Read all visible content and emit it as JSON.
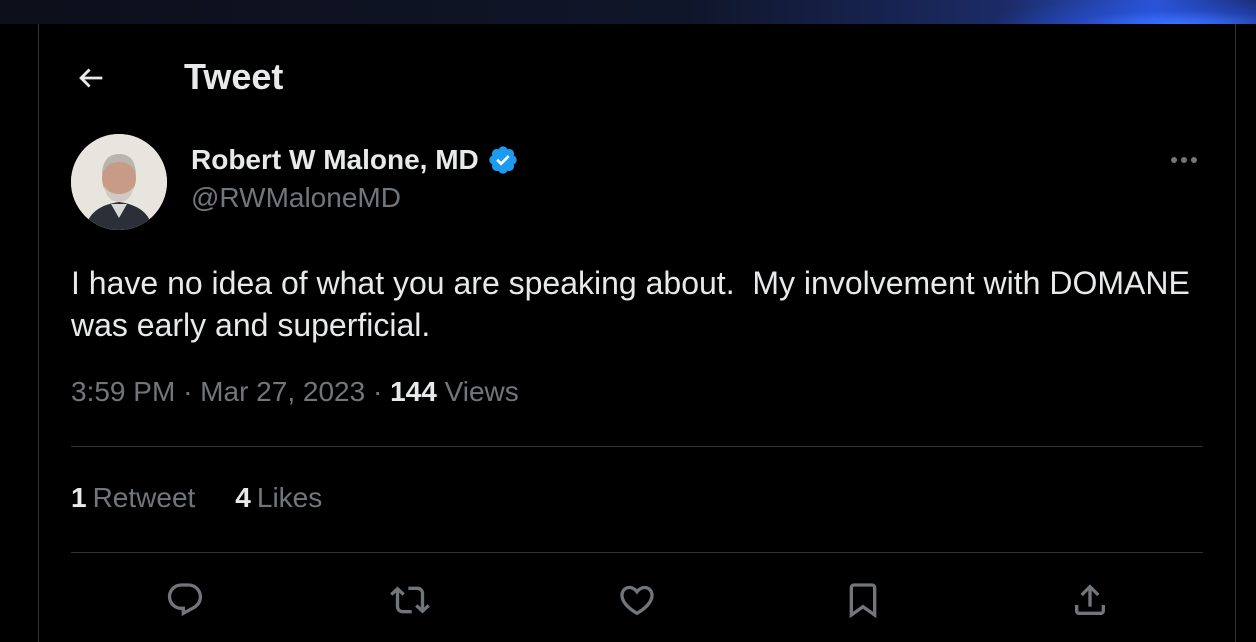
{
  "header": {
    "title": "Tweet",
    "back_icon": "arrow-left-icon"
  },
  "author": {
    "display_name": "Robert W Malone, MD",
    "handle": "@RWMaloneMD",
    "verified_icon": "verified-badge-icon",
    "verified_color": "#1d9bf0"
  },
  "tweet": {
    "text": "I have no idea of what you are speaking about.  My involvement with DOMANE was early and superficial.",
    "time": "3:59 PM",
    "date": "Mar 27, 2023",
    "separator": "·",
    "views_count": "144",
    "views_label": "Views"
  },
  "stats": {
    "retweets_count": "1",
    "retweets_label": "Retweet",
    "likes_count": "4",
    "likes_label": "Likes"
  },
  "actions": [
    {
      "icon": "reply-icon"
    },
    {
      "icon": "retweet-icon"
    },
    {
      "icon": "like-icon"
    },
    {
      "icon": "bookmark-icon"
    },
    {
      "icon": "share-icon"
    }
  ],
  "colors": {
    "background": "#000000",
    "text_primary": "#e7e9ea",
    "text_secondary": "#71767b",
    "border": "#2f3336"
  }
}
